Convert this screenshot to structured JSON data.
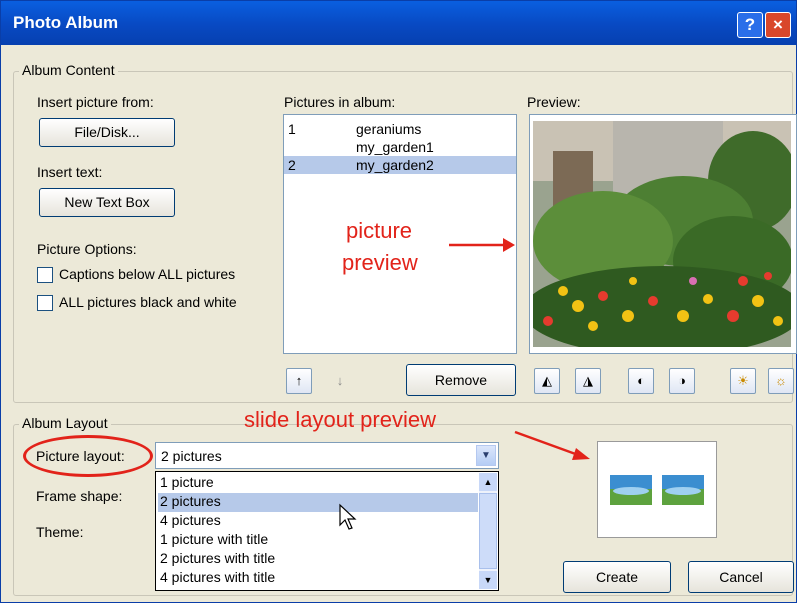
{
  "window": {
    "title": "Photo Album",
    "help_glyph": "?",
    "close_glyph": "×"
  },
  "album_content": {
    "label": "Album Content",
    "insert_picture_from": "Insert picture from:",
    "file_disk_button": "File/Disk...",
    "insert_text": "Insert text:",
    "new_text_box_button": "New Text Box",
    "picture_options": "Picture Options:",
    "captions_checkbox": "Captions below ALL pictures",
    "bw_checkbox": "ALL pictures black and white",
    "pictures_in_album": "Pictures in album:",
    "pictures": [
      {
        "num": "1",
        "name": "geraniums"
      },
      {
        "num": "",
        "name": "my_garden1"
      },
      {
        "num": "2",
        "name": "my_garden2"
      }
    ],
    "preview_label": "Preview:",
    "move_up_glyph": "↑",
    "move_down_glyph": "↓",
    "remove_button": "Remove"
  },
  "album_layout": {
    "label": "Album Layout",
    "picture_layout_label": "Picture layout:",
    "picture_layout_value": "2 pictures",
    "frame_shape_label": "Frame shape:",
    "theme_label": "Theme:",
    "layout_options": [
      "1 picture",
      "2 pictures",
      "4 pictures",
      "1 picture with title",
      "2 pictures with title",
      "4 pictures with title"
    ],
    "selected_option_index": 1
  },
  "footer": {
    "create_button": "Create",
    "cancel_button": "Cancel"
  },
  "annotations": {
    "picture_preview_line1": "picture",
    "picture_preview_line2": "preview",
    "slide_layout_preview": "slide layout preview",
    "color": "#e2231a"
  },
  "icons": [
    "help-icon",
    "close-icon",
    "rotate-left-icon",
    "rotate-right-icon",
    "contrast-up-icon",
    "contrast-down-icon",
    "brightness-up-icon",
    "brightness-down-icon",
    "scroll-up-icon",
    "scroll-down-icon",
    "dropdown-arrow-icon",
    "mouse-cursor-icon"
  ]
}
